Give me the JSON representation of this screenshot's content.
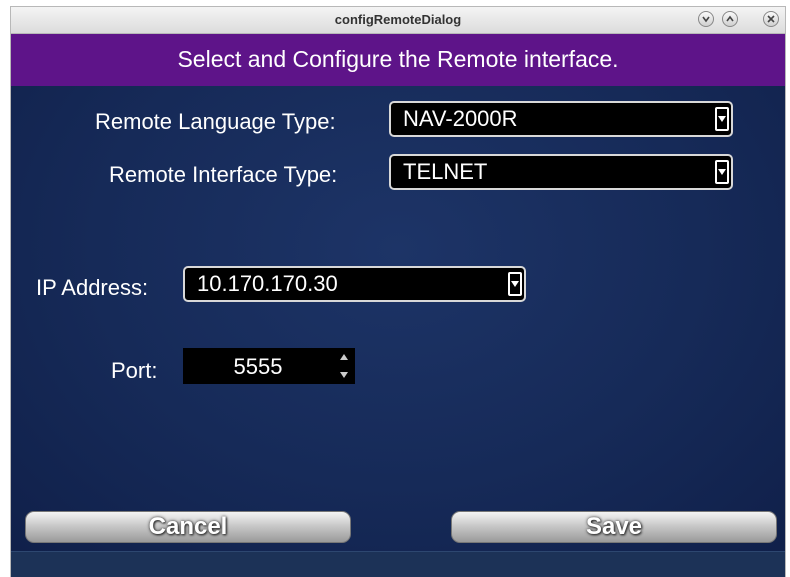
{
  "window": {
    "title": "configRemoteDialog"
  },
  "header": {
    "text": "Select and Configure the Remote interface."
  },
  "form": {
    "language_label": "Remote Language Type:",
    "language_value": "NAV-2000R",
    "interface_label": "Remote Interface Type:",
    "interface_value": "TELNET",
    "ip_label": "IP Address:",
    "ip_value": "10.170.170.30",
    "port_label": "Port:",
    "port_value": "5555"
  },
  "buttons": {
    "cancel": "Cancel",
    "save": "Save"
  },
  "colors": {
    "header_band": "#5e1489",
    "content_bg": "#162a58"
  },
  "icons": {
    "minimize": "chevron-down-icon",
    "maximize": "chevron-up-icon",
    "close": "close-icon",
    "dropdown": "dropdown-arrow-icon",
    "spin": "spin-arrows-icon"
  }
}
